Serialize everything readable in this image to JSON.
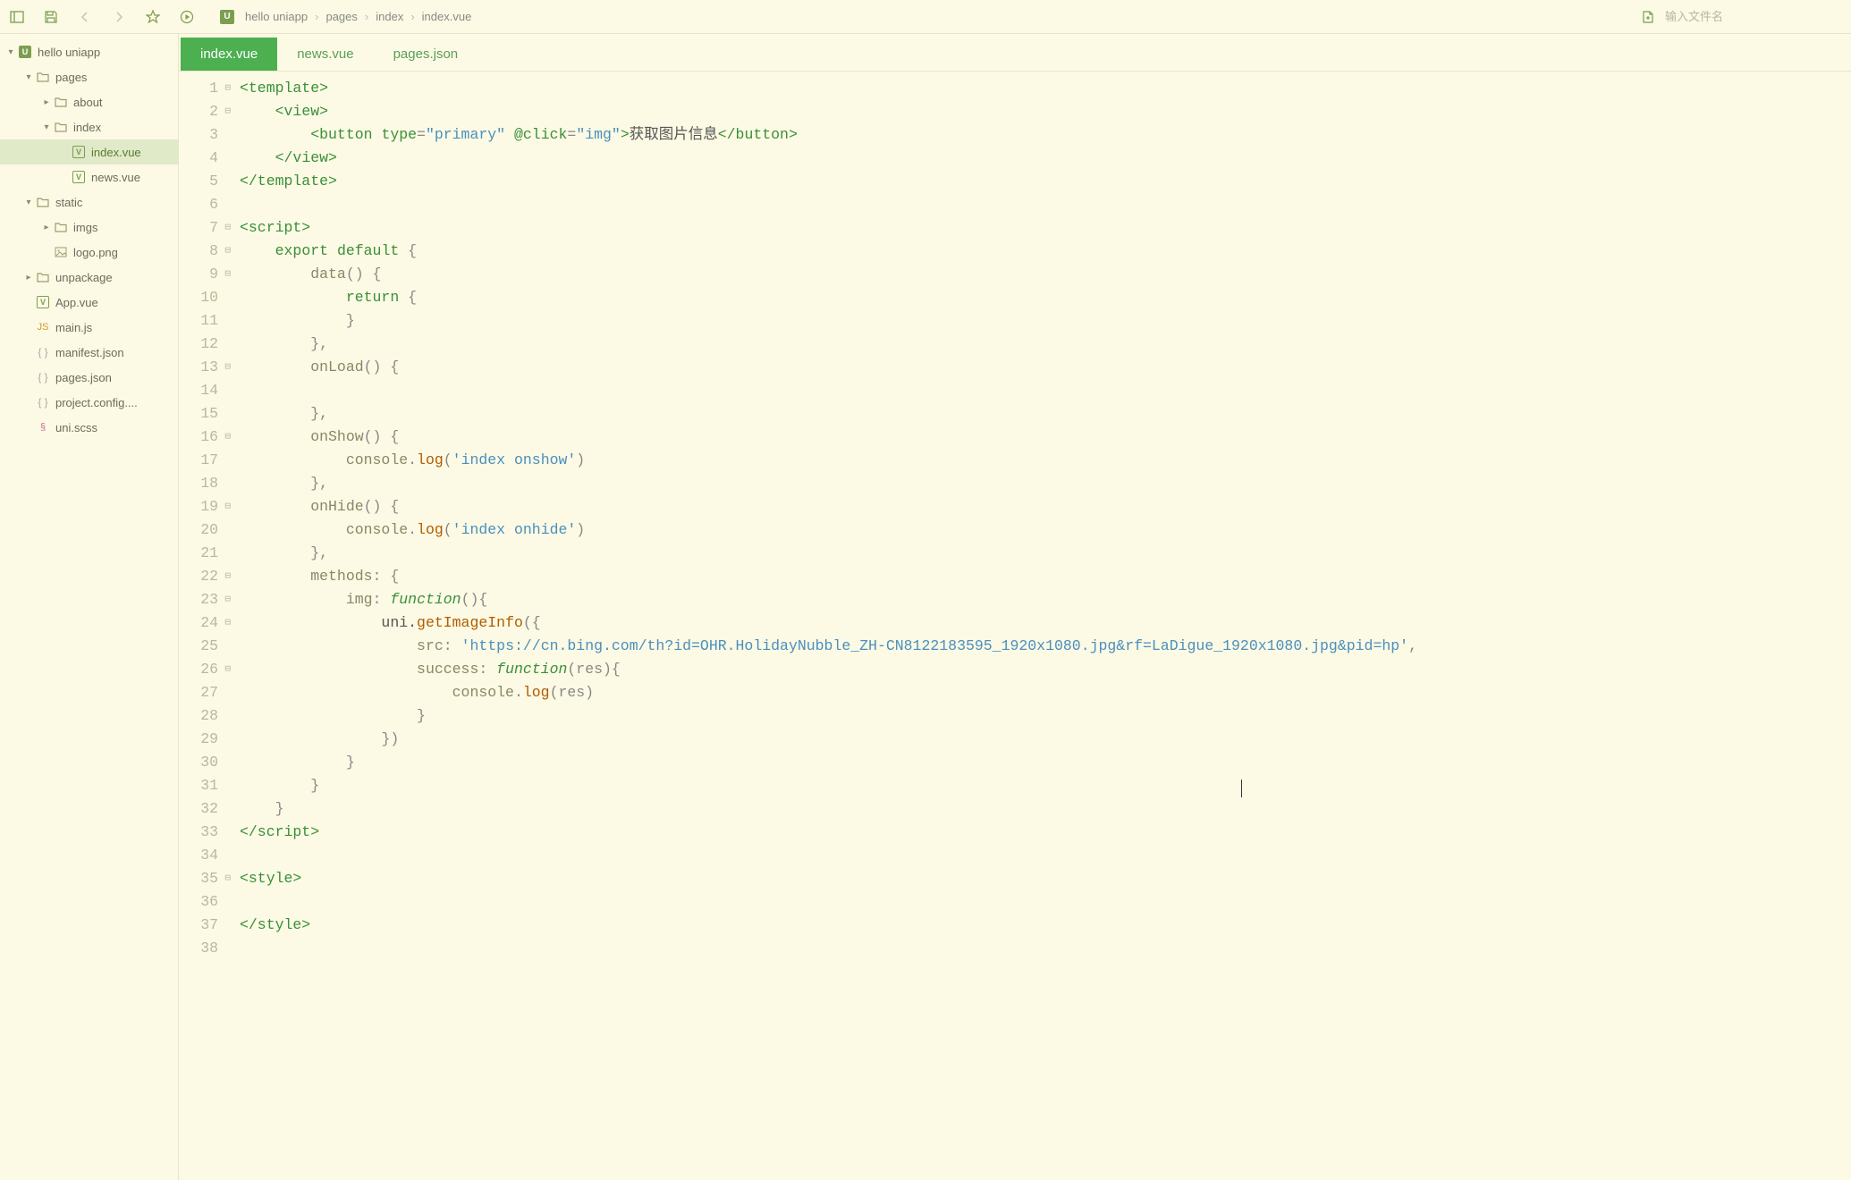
{
  "toolbar": {
    "search_placeholder": "输入文件名"
  },
  "breadcrumb": {
    "badge": "U",
    "items": [
      "hello uniapp",
      "pages",
      "index",
      "index.vue"
    ]
  },
  "tabs": [
    {
      "label": "index.vue",
      "active": true
    },
    {
      "label": "news.vue",
      "active": false
    },
    {
      "label": "pages.json",
      "active": false
    }
  ],
  "tree": [
    {
      "depth": 0,
      "chevron": "down",
      "icon": "project",
      "label": "hello uniapp"
    },
    {
      "depth": 1,
      "chevron": "down",
      "icon": "folder",
      "label": "pages"
    },
    {
      "depth": 2,
      "chevron": "right",
      "icon": "folder",
      "label": "about"
    },
    {
      "depth": 2,
      "chevron": "down",
      "icon": "folder",
      "label": "index"
    },
    {
      "depth": 3,
      "chevron": "",
      "icon": "vue",
      "label": "index.vue",
      "selected": true
    },
    {
      "depth": 3,
      "chevron": "",
      "icon": "vue",
      "label": "news.vue"
    },
    {
      "depth": 1,
      "chevron": "down",
      "icon": "folder",
      "label": "static"
    },
    {
      "depth": 2,
      "chevron": "right",
      "icon": "folder",
      "label": "imgs"
    },
    {
      "depth": 2,
      "chevron": "",
      "icon": "image",
      "label": "logo.png"
    },
    {
      "depth": 1,
      "chevron": "right",
      "icon": "folder",
      "label": "unpackage"
    },
    {
      "depth": 1,
      "chevron": "",
      "icon": "vue",
      "label": "App.vue"
    },
    {
      "depth": 1,
      "chevron": "",
      "icon": "js",
      "label": "main.js"
    },
    {
      "depth": 1,
      "chevron": "",
      "icon": "json",
      "label": "manifest.json"
    },
    {
      "depth": 1,
      "chevron": "",
      "icon": "json",
      "label": "pages.json"
    },
    {
      "depth": 1,
      "chevron": "",
      "icon": "json",
      "label": "project.config...."
    },
    {
      "depth": 1,
      "chevron": "",
      "icon": "scss",
      "label": "uni.scss"
    }
  ],
  "code": {
    "lines": [
      {
        "n": 1,
        "fold": "⊟",
        "tokens": [
          [
            "t-tag",
            "<template>"
          ]
        ]
      },
      {
        "n": 2,
        "fold": "⊟",
        "tokens": [
          [
            "t-plain",
            "    "
          ],
          [
            "t-tag",
            "<view>"
          ]
        ]
      },
      {
        "n": 3,
        "fold": "",
        "tokens": [
          [
            "t-plain",
            "        "
          ],
          [
            "t-tag",
            "<button "
          ],
          [
            "t-attr",
            "type"
          ],
          [
            "t-punc",
            "="
          ],
          [
            "t-str",
            "\"primary\""
          ],
          [
            "t-plain",
            " "
          ],
          [
            "t-attr",
            "@click"
          ],
          [
            "t-punc",
            "="
          ],
          [
            "t-str",
            "\"img\""
          ],
          [
            "t-tag",
            ">"
          ],
          [
            "t-plain",
            "获取图片信息"
          ],
          [
            "t-tag",
            "</button>"
          ]
        ]
      },
      {
        "n": 4,
        "fold": "",
        "tokens": [
          [
            "t-plain",
            "    "
          ],
          [
            "t-tag",
            "</view>"
          ]
        ]
      },
      {
        "n": 5,
        "fold": "",
        "tokens": [
          [
            "t-tag",
            "</template>"
          ]
        ]
      },
      {
        "n": 6,
        "fold": "",
        "tokens": [
          [
            "t-plain",
            ""
          ]
        ]
      },
      {
        "n": 7,
        "fold": "⊟",
        "tokens": [
          [
            "t-tag",
            "<script>"
          ]
        ]
      },
      {
        "n": 8,
        "fold": "⊟",
        "tokens": [
          [
            "t-plain",
            "    "
          ],
          [
            "t-kw",
            "export"
          ],
          [
            "t-plain",
            " "
          ],
          [
            "t-kw",
            "default"
          ],
          [
            "t-plain",
            " "
          ],
          [
            "t-punc",
            "{"
          ]
        ]
      },
      {
        "n": 9,
        "fold": "⊟",
        "tokens": [
          [
            "t-plain",
            "        "
          ],
          [
            "t-prop",
            "data"
          ],
          [
            "t-punc",
            "() {"
          ]
        ]
      },
      {
        "n": 10,
        "fold": "",
        "tokens": [
          [
            "t-plain",
            "            "
          ],
          [
            "t-kw",
            "return"
          ],
          [
            "t-plain",
            " "
          ],
          [
            "t-punc",
            "{"
          ]
        ]
      },
      {
        "n": 11,
        "fold": "",
        "tokens": [
          [
            "t-plain",
            "            "
          ],
          [
            "t-punc",
            "}"
          ]
        ]
      },
      {
        "n": 12,
        "fold": "",
        "tokens": [
          [
            "t-plain",
            "        "
          ],
          [
            "t-punc",
            "},"
          ]
        ]
      },
      {
        "n": 13,
        "fold": "⊟",
        "tokens": [
          [
            "t-plain",
            "        "
          ],
          [
            "t-prop",
            "onLoad"
          ],
          [
            "t-punc",
            "() {"
          ]
        ]
      },
      {
        "n": 14,
        "fold": "",
        "tokens": [
          [
            "t-plain",
            "            "
          ]
        ]
      },
      {
        "n": 15,
        "fold": "",
        "tokens": [
          [
            "t-plain",
            "        "
          ],
          [
            "t-punc",
            "},"
          ]
        ]
      },
      {
        "n": 16,
        "fold": "⊟",
        "tokens": [
          [
            "t-plain",
            "        "
          ],
          [
            "t-prop",
            "onShow"
          ],
          [
            "t-punc",
            "() {"
          ]
        ]
      },
      {
        "n": 17,
        "fold": "",
        "tokens": [
          [
            "t-plain",
            "            "
          ],
          [
            "t-var",
            "console"
          ],
          [
            "t-punc",
            "."
          ],
          [
            "t-method",
            "log"
          ],
          [
            "t-punc",
            "("
          ],
          [
            "t-str",
            "'index onshow'"
          ],
          [
            "t-punc",
            ")"
          ]
        ]
      },
      {
        "n": 18,
        "fold": "",
        "tokens": [
          [
            "t-plain",
            "        "
          ],
          [
            "t-punc",
            "},"
          ]
        ]
      },
      {
        "n": 19,
        "fold": "⊟",
        "tokens": [
          [
            "t-plain",
            "        "
          ],
          [
            "t-prop",
            "onHide"
          ],
          [
            "t-punc",
            "() {"
          ]
        ]
      },
      {
        "n": 20,
        "fold": "",
        "tokens": [
          [
            "t-plain",
            "            "
          ],
          [
            "t-var",
            "console"
          ],
          [
            "t-punc",
            "."
          ],
          [
            "t-method",
            "log"
          ],
          [
            "t-punc",
            "("
          ],
          [
            "t-str",
            "'index onhide'"
          ],
          [
            "t-punc",
            ")"
          ]
        ]
      },
      {
        "n": 21,
        "fold": "",
        "tokens": [
          [
            "t-plain",
            "        "
          ],
          [
            "t-punc",
            "},"
          ]
        ]
      },
      {
        "n": 22,
        "fold": "⊟",
        "tokens": [
          [
            "t-plain",
            "        "
          ],
          [
            "t-prop",
            "methods"
          ],
          [
            "t-punc",
            ": {"
          ]
        ]
      },
      {
        "n": 23,
        "fold": "⊟",
        "tokens": [
          [
            "t-plain",
            "            "
          ],
          [
            "t-prop",
            "img"
          ],
          [
            "t-punc",
            ": "
          ],
          [
            "t-kw2",
            "function"
          ],
          [
            "t-punc",
            "(){"
          ]
        ]
      },
      {
        "n": 24,
        "fold": "⊟",
        "tokens": [
          [
            "t-plain",
            "                uni."
          ],
          [
            "t-method",
            "getImageInfo"
          ],
          [
            "t-punc",
            "({"
          ]
        ]
      },
      {
        "n": 25,
        "fold": "",
        "tokens": [
          [
            "t-plain",
            "                    "
          ],
          [
            "t-prop",
            "src"
          ],
          [
            "t-punc",
            ": "
          ],
          [
            "t-str",
            "'https://cn.bing.com/th?id=OHR.HolidayNubble_ZH-CN8122183595_1920x1080.jpg&rf=LaDigue_1920x1080.jpg&pid=hp'"
          ],
          [
            "t-punc",
            ","
          ]
        ]
      },
      {
        "n": 26,
        "fold": "⊟",
        "tokens": [
          [
            "t-plain",
            "                    "
          ],
          [
            "t-prop",
            "success"
          ],
          [
            "t-punc",
            ": "
          ],
          [
            "t-kw2",
            "function"
          ],
          [
            "t-punc",
            "(res){"
          ]
        ]
      },
      {
        "n": 27,
        "fold": "",
        "tokens": [
          [
            "t-plain",
            "                        "
          ],
          [
            "t-var",
            "console"
          ],
          [
            "t-punc",
            "."
          ],
          [
            "t-method",
            "log"
          ],
          [
            "t-punc",
            "(res)"
          ]
        ]
      },
      {
        "n": 28,
        "fold": "",
        "tokens": [
          [
            "t-plain",
            "                    "
          ],
          [
            "t-punc",
            "}"
          ]
        ]
      },
      {
        "n": 29,
        "fold": "",
        "tokens": [
          [
            "t-plain",
            "                "
          ],
          [
            "t-punc",
            "})"
          ]
        ]
      },
      {
        "n": 30,
        "fold": "",
        "tokens": [
          [
            "t-plain",
            "            "
          ],
          [
            "t-punc",
            "}"
          ]
        ]
      },
      {
        "n": 31,
        "fold": "",
        "tokens": [
          [
            "t-plain",
            "        "
          ],
          [
            "t-punc",
            "}"
          ]
        ]
      },
      {
        "n": 32,
        "fold": "",
        "tokens": [
          [
            "t-plain",
            "    "
          ],
          [
            "t-punc",
            "}"
          ]
        ]
      },
      {
        "n": 33,
        "fold": "",
        "tokens": [
          [
            "t-tag",
            "</script"
          ],
          [
            "t-tag",
            ">"
          ]
        ]
      },
      {
        "n": 34,
        "fold": "",
        "tokens": [
          [
            "t-plain",
            ""
          ]
        ]
      },
      {
        "n": 35,
        "fold": "⊟",
        "tokens": [
          [
            "t-tag",
            "<style>"
          ]
        ]
      },
      {
        "n": 36,
        "fold": "",
        "tokens": [
          [
            "t-plain",
            ""
          ]
        ]
      },
      {
        "n": 37,
        "fold": "",
        "tokens": [
          [
            "t-tag",
            "</style>"
          ]
        ]
      },
      {
        "n": 38,
        "fold": "",
        "tokens": [
          [
            "t-plain",
            ""
          ]
        ]
      }
    ]
  }
}
